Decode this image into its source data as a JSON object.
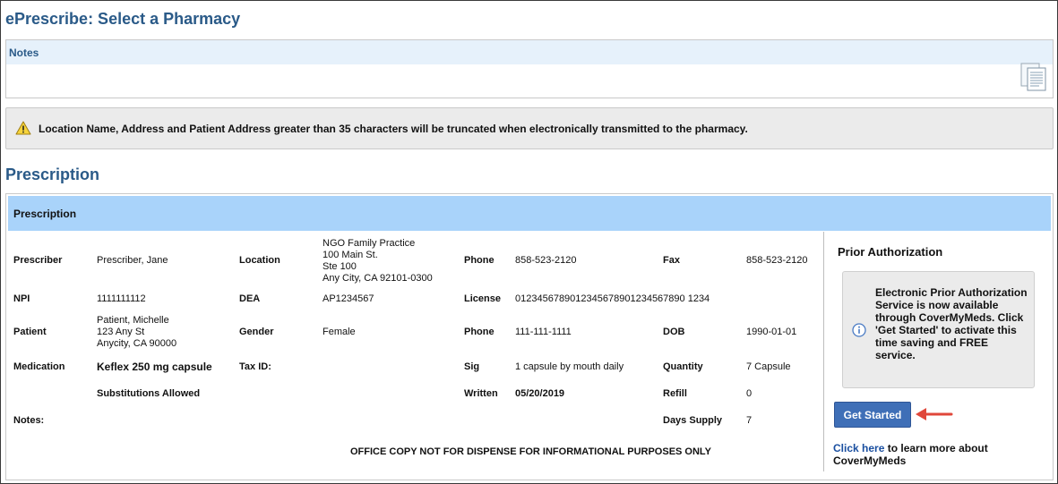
{
  "page_title": "ePrescribe: Select a Pharmacy",
  "notes": {
    "header": "Notes",
    "icon": "notes-document-icon"
  },
  "warning": {
    "icon": "warning-icon",
    "text": "Location Name, Address and Patient Address greater than 35 characters will be truncated when electronically transmitted to the pharmacy."
  },
  "section_title": "Prescription",
  "prescription": {
    "header": "Prescription",
    "labels": {
      "prescriber": "Prescriber",
      "location": "Location",
      "phone": "Phone",
      "fax": "Fax",
      "npi": "NPI",
      "dea": "DEA",
      "license": "License",
      "patient": "Patient",
      "gender": "Gender",
      "patient_phone": "Phone",
      "dob": "DOB",
      "medication": "Medication",
      "tax_id": "Tax ID:",
      "sig": "Sig",
      "quantity": "Quantity",
      "written": "Written",
      "refill": "Refill",
      "notes": "Notes:",
      "days_supply": "Days Supply"
    },
    "values": {
      "prescriber": "Prescriber, Jane",
      "location_lines": [
        "NGO Family Practice",
        "100 Main St.",
        "Ste 100",
        "Any City, CA 92101-0300"
      ],
      "phone": "858-523-2120",
      "fax": "858-523-2120",
      "npi": "1111111112",
      "dea": "AP1234567",
      "license": "0123456789012345678901234567890 1234",
      "patient_lines": [
        "Patient, Michelle",
        "123 Any St",
        "Anycity, CA 90000"
      ],
      "gender": "Female",
      "patient_phone": "111-111-1111",
      "dob": "1990-01-01",
      "medication": "Keflex 250 mg capsule",
      "sig": "1 capsule by mouth daily",
      "quantity": "7 Capsule",
      "substitutions": "Substitutions Allowed",
      "written": "05/20/2019",
      "refill": "0",
      "days_supply": "7"
    },
    "footer_note": "OFFICE COPY NOT FOR DISPENSE FOR INFORMATIONAL PURPOSES ONLY"
  },
  "prior_auth": {
    "title": "Prior Authorization",
    "info_icon": "info-icon",
    "message": "Electronic Prior Authorization Service is now available through CoverMyMeds. Click 'Get Started' to activate this time saving and FREE service.",
    "button_label": "Get Started",
    "link_text": "Click here",
    "link_suffix": " to learn more about CoverMyMeds"
  },
  "colors": {
    "title_blue": "#2a5a88",
    "header_blue": "#a9d3fa",
    "button_blue": "#3f6fb7",
    "arrow_red": "#e0473a"
  }
}
